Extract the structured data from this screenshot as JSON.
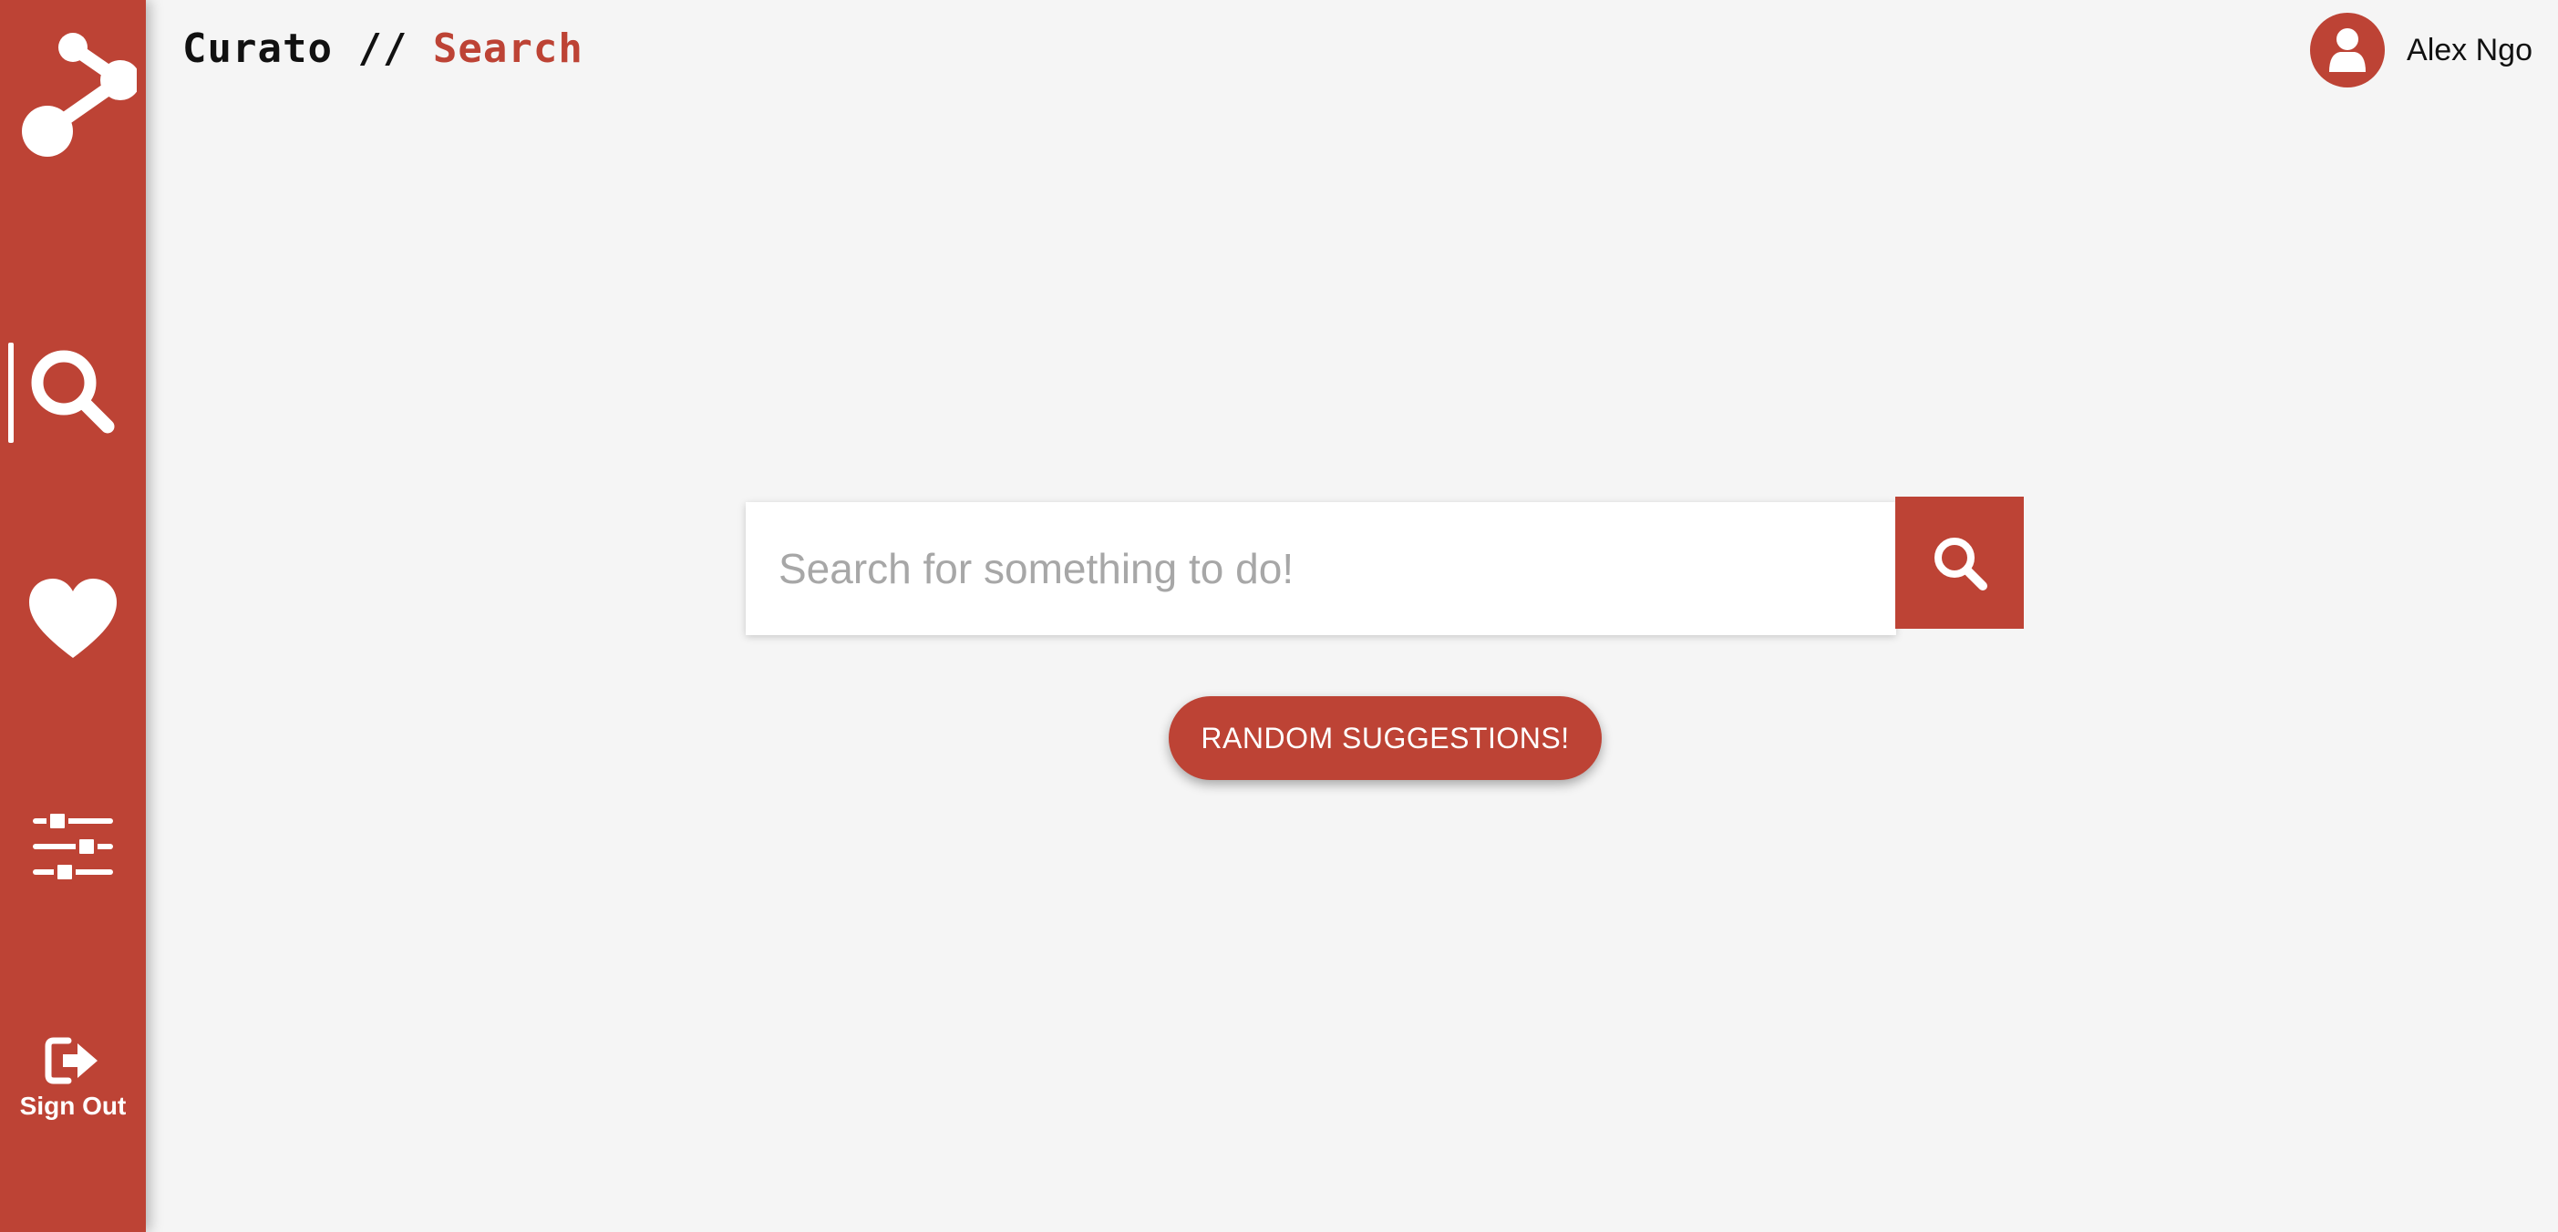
{
  "app": {
    "name": "Curato",
    "separator": " // ",
    "page": "Search"
  },
  "sidebar": {
    "items": [
      {
        "id": "logo",
        "icon": "share-nodes-icon"
      },
      {
        "id": "search",
        "icon": "search-icon",
        "active": true
      },
      {
        "id": "favorites",
        "icon": "heart-icon"
      },
      {
        "id": "preferences",
        "icon": "sliders-icon"
      },
      {
        "id": "sign-out",
        "icon": "sign-out-icon",
        "label": "Sign Out"
      }
    ]
  },
  "user": {
    "name": "Alex Ngo",
    "icon": "user-icon"
  },
  "search": {
    "placeholder": "Search for something to do!",
    "value": "",
    "button_icon": "search-icon"
  },
  "random_button": {
    "label": "RANDOM SUGGESTIONS!"
  },
  "colors": {
    "accent": "#bd4335",
    "background": "#f5f5f5",
    "text": "#111111",
    "placeholder": "#a7a7a7"
  }
}
